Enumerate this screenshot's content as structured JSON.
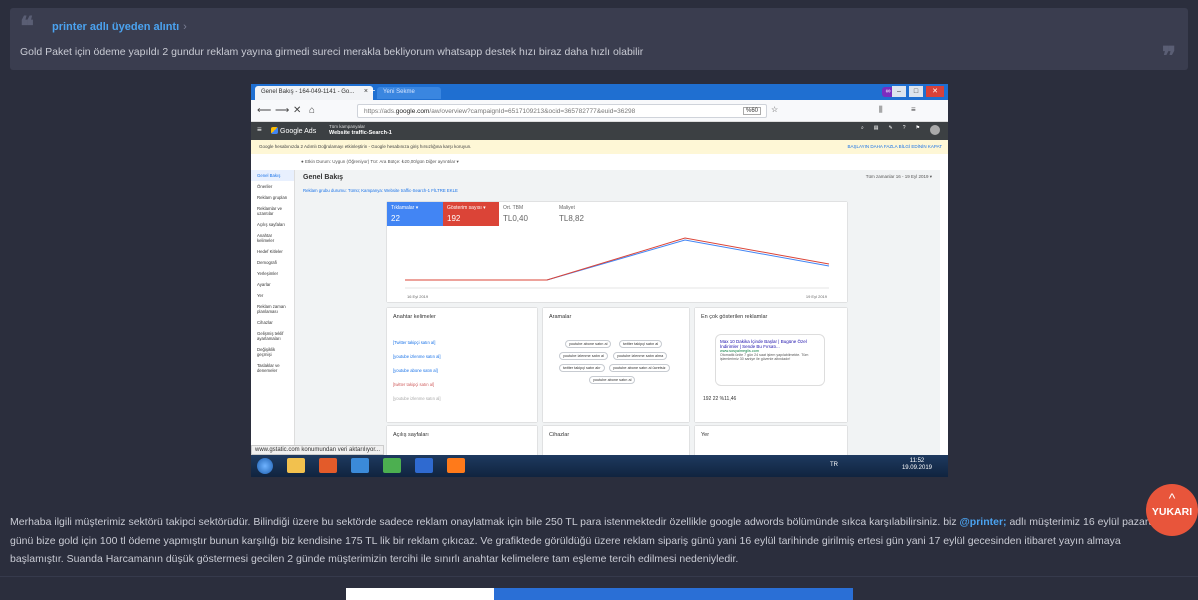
{
  "quote": {
    "author": "printer adlı üyeden alıntı",
    "chevron": "›",
    "text": "Gold Paket için ödeme yapıldı 2 gundur reklam yayına girmedi sureci merakla bekliyorum whatsapp destek hızı biraz daha hızlı olabilir",
    "icon_open": "quote-open-icon",
    "icon_close": "quote-close-icon"
  },
  "screenshot": {
    "tab1": "Genel Bakış - 164-049-1141 - Go...",
    "tab1_close": "×",
    "tab2": "Yeni Sekme",
    "newtab": "+",
    "url_prefix": "https://ads.",
    "url_domain": "google.com",
    "url_rest": "/aw/overview?campaignId=6517109213&ocid=365782777&euid=36298",
    "zoom": "%60",
    "ads_logo": "Google Ads",
    "campaign_small": "Tüm kampanyalar",
    "campaign_name": "Website traffic-Search-1",
    "notice": "Google hesabınızda 2 Adımlı Doğrulamayı etkinleştirin - Google hesabınıza giriş hırsızlığına karşı koruyun.",
    "notice_actions": "BAŞLAYIN   DAHA FAZLA BİLGİ EDİNİN   KAPAT",
    "filters": "● Etkin   Durum: Uygun (Öğreniyor)   Tür: Ara   Bütçe: ₺20,00/gün   Diğer ayrıntılar ▾",
    "page_title": "Genel Bakış",
    "date_sel": "Tüm zamanlar  16 - 19 Eyl 2019 ▾",
    "crumb": "Reklam grubu durumu: Tümü; Kampanya: Website traffic-Search-1   FİLTRE EKLE",
    "sidebar": [
      "Genel Bakış",
      "Öneriler",
      "Reklam grupları",
      "Reklamlar ve uzantılar",
      "Açılış sayfaları",
      "Anahtar kelimeler",
      "Hedef Kitleler",
      "Demografi",
      "Yerleşimler",
      "Ayarlar",
      "Yer",
      "Reklam zaman planlaması",
      "Cihazlar",
      "Gelişmiş teklif ayarlamaları",
      "Değişiklik geçmişi",
      "Taslaklar ve denemeler"
    ],
    "metrics": [
      {
        "label": "Tıklamalar ▾",
        "value": "22"
      },
      {
        "label": "Gösterim sayısı ▾",
        "value": "192"
      },
      {
        "label": "Ort. TBM",
        "value": "TL0,40"
      },
      {
        "label": "Maliyet",
        "value": "TL8,82"
      }
    ],
    "chart_x_start": "16 Eyl 2019",
    "chart_x_end": "19 Eyl 2019",
    "keywords_title": "Anahtar kelimeler",
    "searches_title": "Aramalar",
    "ads_title": "En çok gösterilen reklamlar",
    "landing_title": "Açılış sayfaları",
    "devices_title": "Cihazlar",
    "location_title": "Yer",
    "ad_headline": "Max 10 Dakika İçinde Başlar | Bugüne Özel İndirimler | Sende Bu Fırsatı...",
    "ad_url": "www.sosyalmeglis.com",
    "ad_desc": "Otomatik ünite 7 gün 24 saat işlem yapılabilmekte. Tüm işlemlerimiz 30 saniye ile güvenle altındadır!",
    "ad_stats": "192   22   %11,46",
    "keyword_rows": [
      "[Twitter takipçi satın al]",
      "[youtube izlenme satın al]",
      "[youtube abone satın al]",
      "[twitter takipçi satın al]",
      "[youtube izlenme satın al]"
    ],
    "search_pills": [
      "youtube abone satın al",
      "twitter takipçi satın al",
      "youtube izlenme satın al",
      "youtube izlenme satın alma",
      "twitter takipçi satın alır",
      "youtube abone satın al ücretsiz",
      "youtube abone satın al"
    ],
    "status_url": "www.gstatic.com konumundan veri aktarılıyor...",
    "clock_time": "11:52",
    "clock_date": "19.09.2019",
    "lang": "TR"
  },
  "reply": {
    "part1": "Merhaba ilgili müşterimiz sektörü takipci sektörüdür. Bilindiği üzere bu sektörde sadece reklam onaylatmak için bile 250 TL para istenmektedir özellikle google adwords bölümünde sıkca karşılabilirsiniz. biz ",
    "mention": "@printer;",
    "part2": " adlı müşterimiz 16 eylül pazartesi günü bize gold için 100 tl ödeme yapmıştır bunun karşılığı biz kendisine 175 TL lik bir reklam çıkıcaz. Ve grafiktede görüldüğü üzere reklam sipariş günü yani 16 eylül tarihinde girilmiş ertesi gün yani 17 eylül gecesinden itibaret yayın almaya başlamıştır. Suanda Harcamanın düşük göstermesi gecilen 2 günde müşterimizin tercihi ile sınırlı anahtar kelimelere tam eşleme tercih edilmesi nedeniyledir."
  },
  "scroll_top": {
    "label": "YUKARI",
    "arrow": "^"
  },
  "colors": {
    "bg": "#2b2e3d",
    "quote_bg": "#3a3d4f",
    "accent": "#4ba3f0",
    "scroll_btn": "#e8553b"
  }
}
